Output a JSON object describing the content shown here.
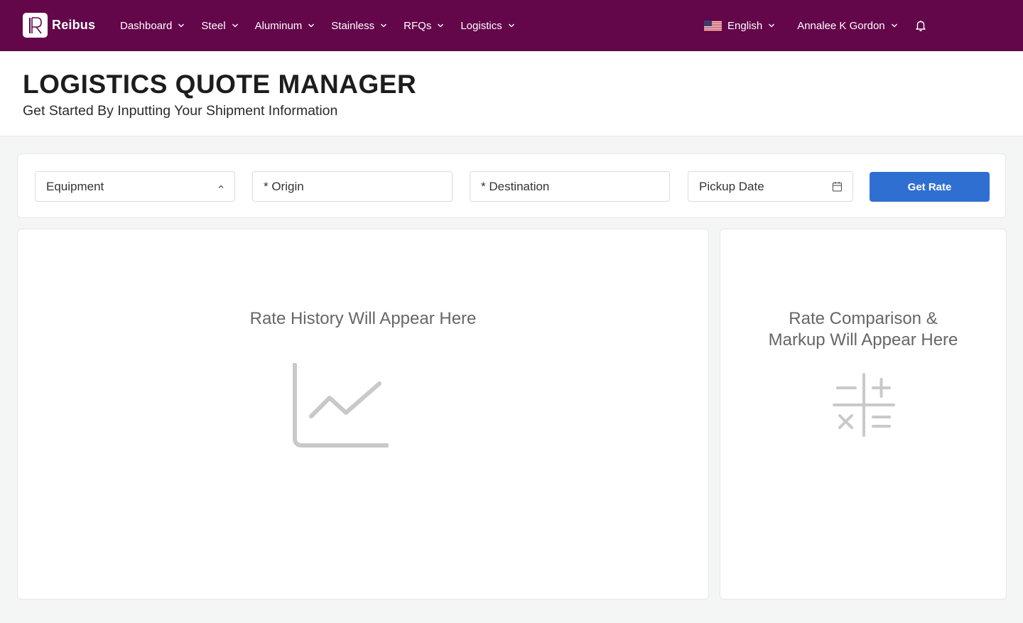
{
  "brand": {
    "name": "Reibus"
  },
  "nav": {
    "items": [
      {
        "label": "Dashboard"
      },
      {
        "label": "Steel"
      },
      {
        "label": "Aluminum"
      },
      {
        "label": "Stainless"
      },
      {
        "label": "RFQs"
      },
      {
        "label": "Logistics"
      }
    ],
    "language": "English",
    "user": "Annalee K Gordon"
  },
  "header": {
    "title": "LOGISTICS QUOTE MANAGER",
    "subtitle": "Get Started By Inputting Your Shipment Information"
  },
  "form": {
    "equipment_label": "Equipment",
    "origin_placeholder": "* Origin",
    "destination_placeholder": "* Destination",
    "pickup_placeholder": "Pickup Date",
    "submit_label": "Get Rate"
  },
  "panels": {
    "rate_history": "Rate History Will Appear Here",
    "rate_comparison_line1": "Rate Comparison &",
    "rate_comparison_line2": "Markup Will Appear Here"
  },
  "colors": {
    "nav_bg": "#63064a",
    "accent": "#2f6fd1",
    "placeholder_icon": "#c9c9cc"
  }
}
